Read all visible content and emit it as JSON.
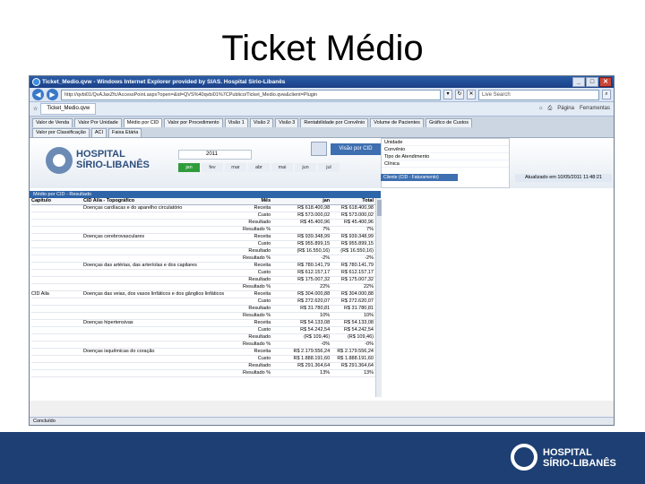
{
  "slide": {
    "title": "Ticket Médio"
  },
  "window": {
    "title": "Ticket_Medio.qvw - Windows Internet Explorer provided by SIAS. Hospital Sirio-Libanês",
    "address": "http://qvbi01/QvAJaxZfc/AccessPoint.aspx?open=&id=QVS%40qvbi01%7CPublico/Ticket_Medio.qvw&client=Plugin",
    "search_placeholder": "Live Search",
    "tab_label": "Ticket_Medio.qvw",
    "tools": [
      "Página",
      "Ferramentas"
    ]
  },
  "qv_tabs_row1": [
    "Valor de Venda",
    "Valor Por Unidade",
    "Médio por CID",
    "Valor por Procedimento",
    "Visão 1",
    "Visão 2",
    "Visão 3",
    "Rentabilidade por Convênio",
    "Volume de Pacientes",
    "Gráfico de Custos"
  ],
  "qv_tabs_row2": [
    "Valor por Classificação",
    "ACI",
    "Faixa Etária"
  ],
  "header": {
    "logo_line1": "HOSPITAL",
    "logo_line2": "SÍRIO-LIBANÊS",
    "year": "2011",
    "months": [
      "jan",
      "fev",
      "mar",
      "abr",
      "mai",
      "jun",
      "jul"
    ],
    "action_button": "Visão por CID",
    "filters": [
      "Unidade",
      "Convênio",
      "Tipo de Atendimento",
      "Clínica"
    ],
    "filter_selected": "Cliente (CID - Faturamento)",
    "updated": "Atualizado em 10/05/2011 11:48:21"
  },
  "report": {
    "bar_label": "Médio por CID - Resultado",
    "columns": [
      "Capítulo",
      "CID Aila - Topográfico",
      "Mês",
      "jan",
      "Total"
    ],
    "rows": [
      [
        "",
        "Doenças cardíacas e do aparelho circulatório",
        "Receita",
        "R$ 618.400,98",
        "R$ 618.400,98"
      ],
      [
        "",
        "",
        "Custo",
        "R$ 573.000,02",
        "R$ 573.000,02"
      ],
      [
        "",
        "",
        "Resultado",
        "R$ 45.400,96",
        "R$ 45.400,96"
      ],
      [
        "",
        "",
        "Resultado %",
        "7%",
        "7%"
      ],
      [
        "",
        "Doenças cerebrovasculares",
        "Receita",
        "R$ 939.348,99",
        "R$ 939.348,99"
      ],
      [
        "",
        "",
        "Custo",
        "R$ 955.899,15",
        "R$ 955.899,15"
      ],
      [
        "",
        "",
        "Resultado",
        "(R$ 16.550,16)",
        "(R$ 16.550,16)"
      ],
      [
        "",
        "",
        "Resultado %",
        "-2%",
        "-2%"
      ],
      [
        "",
        "Doenças das artérias, das arteríolas e dos capilares",
        "Receita",
        "R$ 780.141,79",
        "R$ 780.141,79"
      ],
      [
        "",
        "",
        "Custo",
        "R$ 612.157,17",
        "R$ 612.157,17"
      ],
      [
        "",
        "",
        "Resultado",
        "R$ 175.007,32",
        "R$ 175.007,32"
      ],
      [
        "",
        "",
        "Resultado %",
        "22%",
        "22%"
      ],
      [
        "CID Aila",
        "Doenças das veias, dos vasos linfáticos e dos gânglios linfáticos",
        "Receita",
        "R$ 304.000,88",
        "R$ 304.000,88"
      ],
      [
        "",
        "",
        "Custo",
        "R$ 272.620,07",
        "R$ 272.620,07"
      ],
      [
        "",
        "",
        "Resultado",
        "R$ 31.780,81",
        "R$ 31.780,81"
      ],
      [
        "",
        "",
        "Resultado %",
        "10%",
        "10%"
      ],
      [
        "",
        "Doenças hipertensivas",
        "Receita",
        "R$ 54.133,08",
        "R$ 54.133,08"
      ],
      [
        "",
        "",
        "Custo",
        "R$ 54.242,54",
        "R$ 54.242,54"
      ],
      [
        "",
        "",
        "Resultado",
        "(R$ 109,46)",
        "(R$ 109,46)"
      ],
      [
        "",
        "",
        "Resultado %",
        "-0%",
        "-0%"
      ],
      [
        "",
        "Doenças isquêmicas do coração",
        "Receita",
        "R$ 2.179.556,24",
        "R$ 2.179.556,24"
      ],
      [
        "",
        "",
        "Custo",
        "R$ 1.888.191,60",
        "R$ 1.888.191,60"
      ],
      [
        "",
        "",
        "Resultado",
        "R$ 291.364,64",
        "R$ 291.364,64"
      ],
      [
        "",
        "",
        "Resultado %",
        "13%",
        "13%"
      ]
    ]
  },
  "statusbar": "Concluído",
  "footer": {
    "logo_line1": "HOSPITAL",
    "logo_line2": "SÍRIO-LIBANÊS"
  }
}
